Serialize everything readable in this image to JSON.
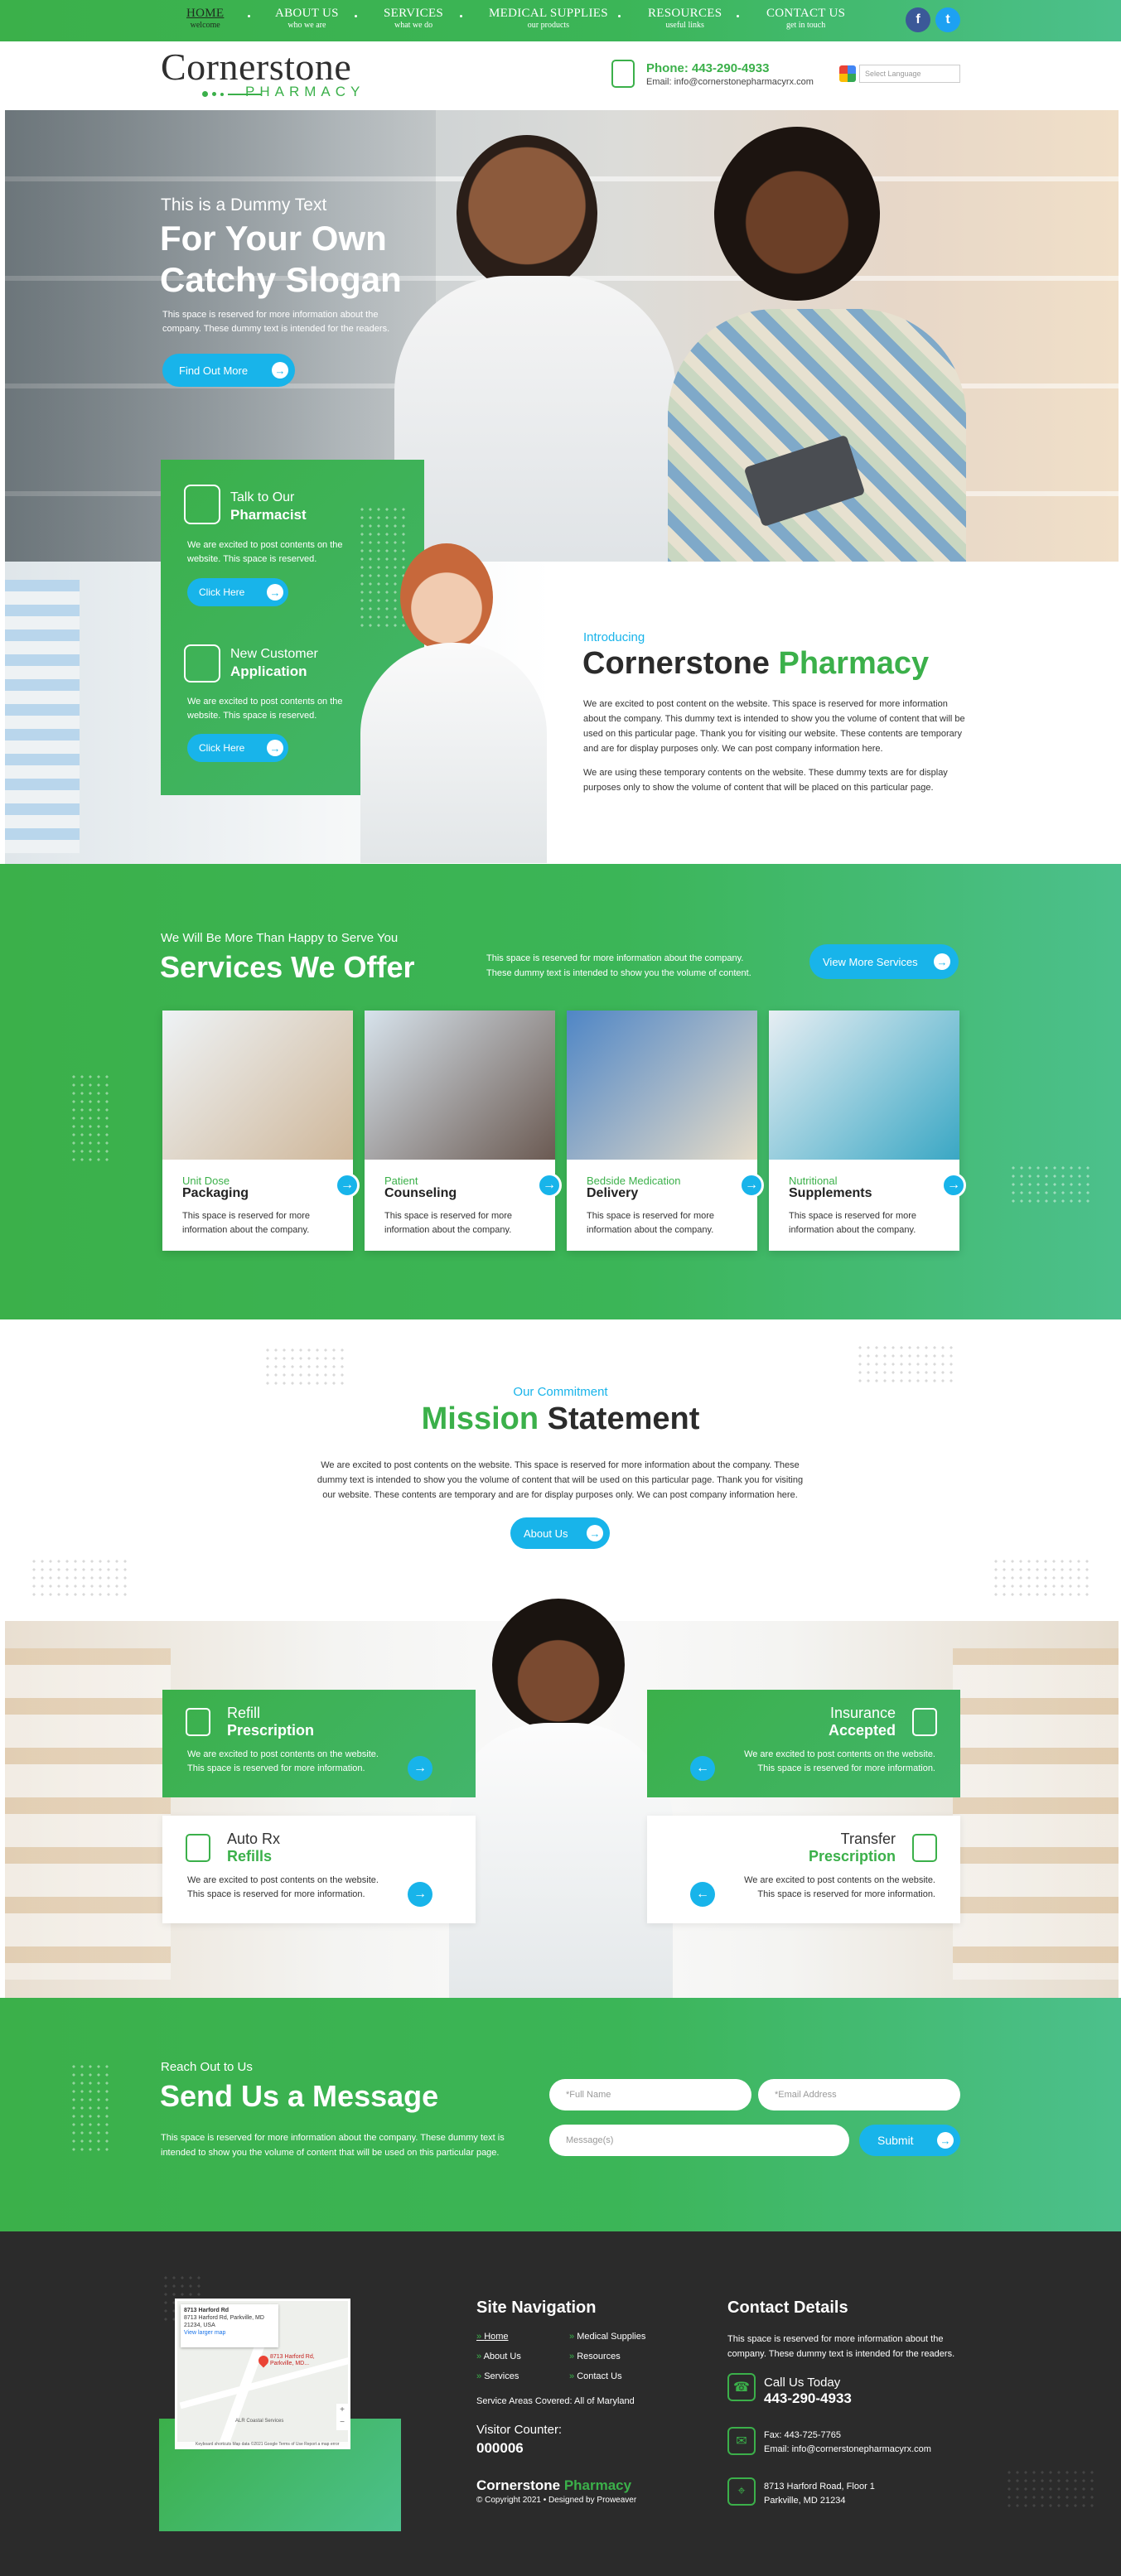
{
  "nav": {
    "items": [
      {
        "label": "HOME",
        "sub": "welcome"
      },
      {
        "label": "ABOUT US",
        "sub": "who we are"
      },
      {
        "label": "SERVICES",
        "sub": "what we do"
      },
      {
        "label": "MEDICAL SUPPLIES",
        "sub": "our products"
      },
      {
        "label": "RESOURCES",
        "sub": "useful links"
      },
      {
        "label": "CONTACT US",
        "sub": "get in touch"
      }
    ],
    "social": {
      "facebook": "f",
      "twitter": "t"
    }
  },
  "header": {
    "logo_main": "Cornerstone",
    "logo_sub": "PHARMACY",
    "phone": "Phone: 443-290-4933",
    "email": "Email: info@cornerstonepharmacyrx.com",
    "language_placeholder": "Select Language"
  },
  "hero": {
    "kicker": "This is a Dummy Text",
    "title_line1": "For Your Own",
    "title_line2": "Catchy Slogan",
    "text": "This space is reserved for more information about the company. These dummy text is intended for the readers.",
    "button": "Find Out More"
  },
  "quick": [
    {
      "line1": "Talk to Our",
      "line2": "Pharmacist",
      "text": "We are excited to post contents on the website. This space is reserved.",
      "button": "Click Here",
      "icon": "pharmacist-icon"
    },
    {
      "line1": "New Customer",
      "line2": "Application",
      "text": "We are excited to post contents on the website. This space is reserved.",
      "button": "Click Here",
      "icon": "application-icon"
    }
  ],
  "intro": {
    "kicker": "Introducing",
    "title_a": "Cornerstone",
    "title_b": "Pharmacy",
    "p1": "We are excited to post content on the website. This space is reserved for more information about the company. This dummy text is intended to show you the volume of content that will be used on this particular page. Thank you for visiting our website. These contents are temporary and are for display purposes only. We can post company information here.",
    "p2": "We are using these temporary contents on the website. These dummy texts are for display purposes only to show the volume of content that will be placed on this particular page."
  },
  "services": {
    "kicker": "We Will Be More Than Happy to Serve You",
    "title": "Services We Offer",
    "text": "This space is reserved for more information about the company. These dummy text is intended to show you the volume of content.",
    "button": "View More Services",
    "cards": [
      {
        "sub": "Unit Dose",
        "title": "Packaging",
        "text": "This space is reserved for more information about the company."
      },
      {
        "sub": "Patient",
        "title": "Counseling",
        "text": "This space is reserved for more information about the company."
      },
      {
        "sub": "Bedside Medication",
        "title": "Delivery",
        "text": "This space is reserved for more information about the company."
      },
      {
        "sub": "Nutritional",
        "title": "Supplements",
        "text": "This space is reserved for more information about the company."
      }
    ]
  },
  "mission": {
    "kicker": "Our Commitment",
    "title_a": "Mission",
    "title_b": "Statement",
    "text": "We are excited to post contents on the website. This space is reserved for more information about the company. These dummy text is intended to show you the volume of content that will be used on this particular page. Thank you for visiting our website. These contents are temporary and are for display purposes only. We can post company information here.",
    "button": "About Us"
  },
  "features": [
    {
      "line1": "Refill",
      "line2": "Prescription",
      "text": "We are excited to post contents on the website. This space is reserved for more information."
    },
    {
      "line1": "Insurance",
      "line2": "Accepted",
      "text": "We are excited to post contents on the website. This space is reserved for more information."
    },
    {
      "line1": "Auto Rx",
      "line2": "Refills",
      "text": "We are excited to post contents on the website. This space is reserved for more information."
    },
    {
      "line1": "Transfer",
      "line2": "Prescription",
      "text": "We are excited to post contents on the website. This space is reserved for more information."
    }
  ],
  "contact": {
    "kicker": "Reach Out to Us",
    "title": "Send Us a Message",
    "text": "This space is reserved for more information about the company. These dummy text is intended to show you the volume of content that will be used on this particular page.",
    "full_name": "*Full Name",
    "email": "*Email Address",
    "message": "Message(s)",
    "submit": "Submit"
  },
  "footer": {
    "map_title": "8713 Harford Rd",
    "map_addr": "8713 Harford Rd, Parkville, MD 21234, USA",
    "map_link": "View larger map",
    "map_pin": "8713 Harford Rd, Parkville, MD...",
    "map_place": "ALR Coastal Services",
    "map_footer": "Keyboard shortcuts   Map data ©2021 Google   Terms of Use   Report a map error",
    "nav_title": "Site Navigation",
    "nav_col1": [
      "Home",
      "About Us",
      "Services"
    ],
    "nav_col2": [
      "Medical Supplies",
      "Resources",
      "Contact Us"
    ],
    "service_areas": "Service Areas Covered: All of Maryland",
    "visitor_label": "Visitor Counter:",
    "visitor_count": "000006",
    "brand_a": "Cornerstone",
    "brand_b": "Pharmacy",
    "copyright": "© Copyright 2021 • Designed by Proweaver",
    "contact_title": "Contact Details",
    "contact_text": "This space is reserved for more information about the company. These dummy text is intended for the readers.",
    "call_label": "Call Us Today",
    "call_number": "443-290-4933",
    "fax": "Fax: 443-725-7765",
    "email": "Email: info@cornerstonepharmacyrx.com",
    "address1": "8713 Harford Road, Floor 1",
    "address2": "Parkville, MD 21234"
  },
  "colors": {
    "green": "#3bb04a",
    "teal": "#4cc08c",
    "blue": "#18b4ea",
    "dark": "#2b2b2b"
  }
}
